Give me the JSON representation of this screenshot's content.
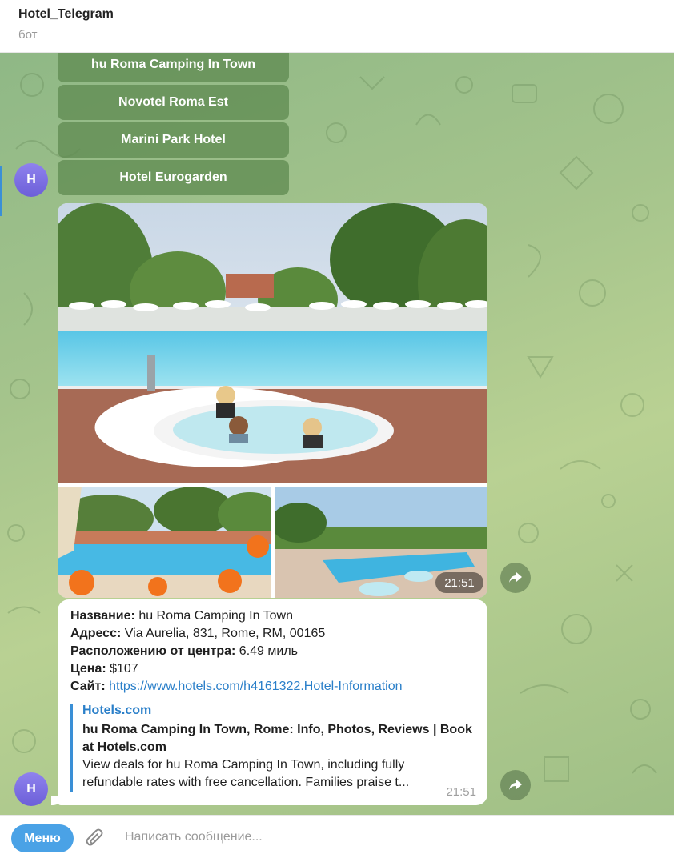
{
  "header": {
    "title": "Hotel_Telegram",
    "subtitle": "бот"
  },
  "keyboard": {
    "buttons": [
      {
        "label": "hu Roma Camping In Town"
      },
      {
        "label": "Novotel Roma Est"
      },
      {
        "label": "Marini Park Hotel"
      },
      {
        "label": "Hotel Eurogarden"
      }
    ]
  },
  "avatar": {
    "initial": "H"
  },
  "album": {
    "time": "21:51"
  },
  "message": {
    "name_label": "Название:",
    "name_value": "hu Roma Camping In Town",
    "address_label": "Адресс:",
    "address_value": "Via Aurelia, 831, Rome, RM, 00165",
    "distance_label": "Расположению от центра:",
    "distance_value": "6.49 миль",
    "price_label": "Цена:",
    "price_value": "$107",
    "site_label": "Сайт:",
    "site_url": "https://www.hotels.com/h4161322.Hotel-Information",
    "preview": {
      "site_name": "Hotels.com",
      "title": "hu Roma Camping In Town, Rome: Info, Photos, Reviews | Book at Hotels.com",
      "description": "View deals for hu Roma Camping In Town, including fully refundable rates with free cancellation. Families praise t..."
    },
    "time": "21:51"
  },
  "composer": {
    "menu_label": "Меню",
    "placeholder": "Написать сообщение..."
  },
  "colors": {
    "accent": "#4aa2e6",
    "link": "#2a7fc9",
    "avatar": "#7b6fe3"
  }
}
